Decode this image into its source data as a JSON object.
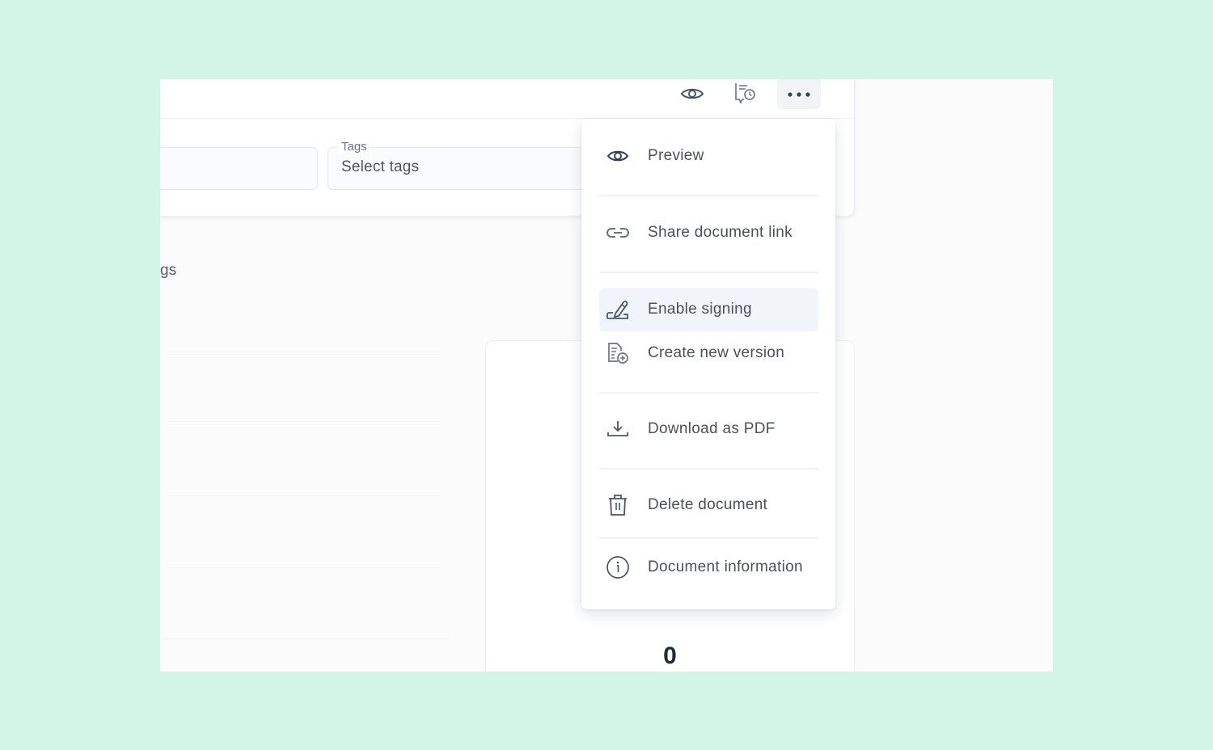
{
  "toolbar": {
    "buttons": [
      {
        "name": "preview",
        "icon": "eye-icon"
      },
      {
        "name": "version-history",
        "icon": "document-clock-icon"
      },
      {
        "name": "more-options",
        "icon": "more-horizontal-icon"
      }
    ]
  },
  "form": {
    "left_field": {
      "value": ""
    },
    "tags": {
      "label": "Tags",
      "placeholder": "Select tags"
    }
  },
  "page": {
    "section_label_fragment": "gs",
    "stat_value": "0"
  },
  "menu": {
    "items": [
      {
        "label": "Preview",
        "icon": "eye-icon",
        "active": false
      },
      {
        "label": "Share document link",
        "icon": "link-icon",
        "active": false
      },
      {
        "label": "Enable signing",
        "icon": "signature-pen-icon",
        "active": true
      },
      {
        "label": "Create new version",
        "icon": "document-plus-icon",
        "active": false
      },
      {
        "label": "Download as PDF",
        "icon": "download-icon",
        "active": false
      },
      {
        "label": "Delete document",
        "icon": "trash-icon",
        "active": false
      },
      {
        "label": "Document information",
        "icon": "info-icon",
        "active": false
      }
    ]
  },
  "colors": {
    "backdrop": "#d3f5e7",
    "menu_active_bg": "#f1f4f9",
    "text": "#4b5058"
  }
}
